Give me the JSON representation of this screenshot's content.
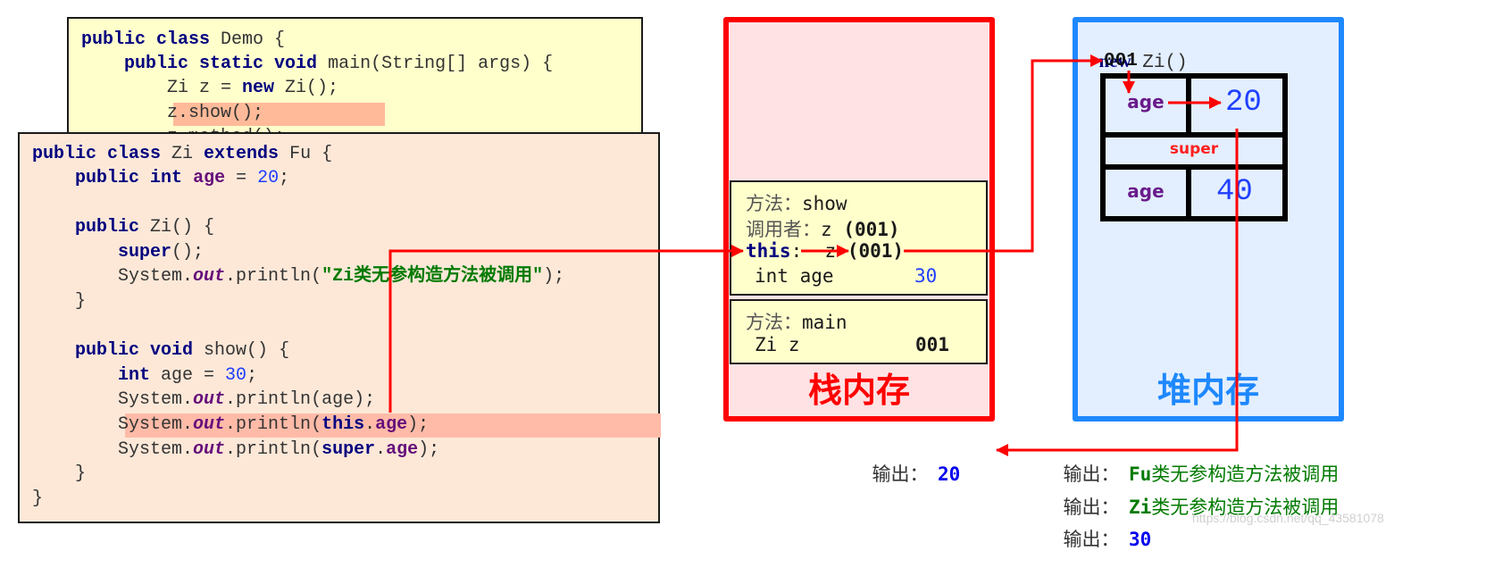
{
  "demo_class": {
    "lines": [
      {
        "kw1": "public class",
        "rest": " Demo {"
      },
      {
        "indent": "    ",
        "kw1": "public static void",
        "rest": " main(String[] args) {"
      },
      {
        "indent": "        ",
        "pre": "Zi z = ",
        "kw1": "new",
        "rest": " Zi();"
      },
      {
        "indent": "        ",
        "pre": "z.show();"
      },
      {
        "indent": "        ",
        "pre": "z.method();"
      }
    ],
    "highlight_line": "z.show();"
  },
  "zi_class": {
    "l1": {
      "kw": "public class",
      "name": " Zi ",
      "kw2": "extends",
      "rest": " Fu {"
    },
    "l2": {
      "kw": "public int",
      "field": "age",
      "eq": " = ",
      "num": "20",
      "end": ";"
    },
    "l4": {
      "kw": "public",
      "rest": " Zi() {"
    },
    "l5": {
      "kw": "super",
      "rest": "();"
    },
    "l6": {
      "pre": "System.",
      "out": "out",
      "mid": ".println(",
      "str": "\"Zi类无参构造方法被调用\"",
      "end": ");"
    },
    "l7": "}",
    "l9": {
      "kw": "public void",
      "rest": " show() {"
    },
    "l10": {
      "kw": "int",
      "rest": " age = ",
      "num": "30",
      "end": ";"
    },
    "l11": {
      "pre": "System.",
      "out": "out",
      "mid": ".println(age);"
    },
    "l12": {
      "pre": "System.",
      "out": "out",
      "mid": ".println(",
      "kw": "this",
      "dot": ".",
      "field": "age",
      "end": ");"
    },
    "l13": {
      "pre": "System.",
      "out": "out",
      "mid": ".println(",
      "kw": "super",
      "dot": ".",
      "field": "age",
      "end": ");"
    },
    "l14": "}",
    "l15": "}"
  },
  "stack": {
    "title": "栈内存",
    "border_color": "#ff0000",
    "fill_color": "#ffe2e4",
    "show_frame": {
      "method_label": "方法：",
      "method_name": "show",
      "caller_label": "调用者：",
      "caller_value": "z",
      "caller_addr": "(001)",
      "this_label": "this",
      "this_sep": ":",
      "this_value": "z",
      "this_addr": "(001)",
      "local_var": "int age",
      "local_value": "30"
    },
    "main_frame": {
      "method_label": "方法：",
      "method_name": "main",
      "var": "Zi z",
      "value": "001"
    }
  },
  "heap": {
    "title": "堆内存",
    "border_color": "#1e88ff",
    "fill_color": "#e3efff",
    "new_kw": "new",
    "new_rest": " Zi()",
    "address": "001",
    "field_label": "age",
    "field_value": "20",
    "super_label": "super",
    "super_field_label": "age",
    "super_field_value": "40"
  },
  "outputs": {
    "left": {
      "label": "输出：",
      "value": "20"
    },
    "right": [
      {
        "label": "输出：",
        "prefix": "Fu",
        "value": "类无参构造方法被调用"
      },
      {
        "label": "输出：",
        "prefix": "Zi",
        "value": "类无参构造方法被调用"
      },
      {
        "label": "输出：",
        "value": "30"
      }
    ]
  },
  "watermark": "https://blog.csdn.net/qq_43581078"
}
